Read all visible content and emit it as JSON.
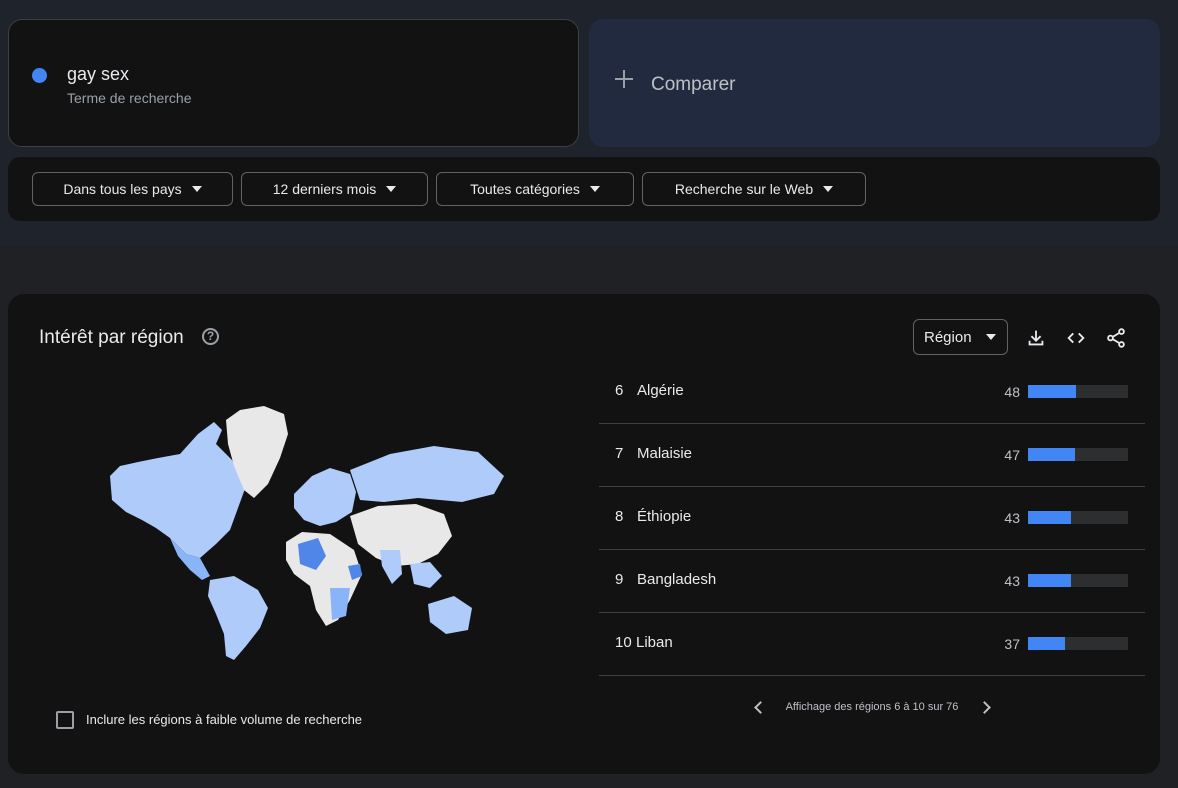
{
  "search_term": {
    "name": "gay sex",
    "type": "Terme de recherche",
    "color": "#4285f4"
  },
  "compare": {
    "label": "Comparer"
  },
  "filters": [
    {
      "label": "Dans tous les pays"
    },
    {
      "label": "12 derniers mois"
    },
    {
      "label": "Toutes catégories"
    },
    {
      "label": "Recherche sur le Web"
    }
  ],
  "panel": {
    "title": "Intérêt par région",
    "help_icon": "help-circle-icon",
    "resolution_select": "Région",
    "tools": [
      "download-icon",
      "embed-code-icon",
      "share-icon"
    ]
  },
  "regions": [
    {
      "rank": "6",
      "name": "Algérie",
      "value": 48
    },
    {
      "rank": "7",
      "name": "Malaisie",
      "value": 47
    },
    {
      "rank": "8",
      "name": "Éthiopie",
      "value": 43
    },
    {
      "rank": "9",
      "name": "Bangladesh",
      "value": 43
    },
    {
      "rank": "10",
      "name": "Liban",
      "value": 37
    }
  ],
  "low_volume_checkbox": {
    "label": "Inclure les régions à faible volume de recherche",
    "checked": false
  },
  "pagination": {
    "text": "Affichage des régions 6 à 10 sur 76"
  },
  "colors": {
    "accent": "#4285f4",
    "map_light": "#aecbfa",
    "map_mid": "#8ab4f8",
    "map_dark": "#4f86e8",
    "map_nodata": "#e8e8e8"
  }
}
